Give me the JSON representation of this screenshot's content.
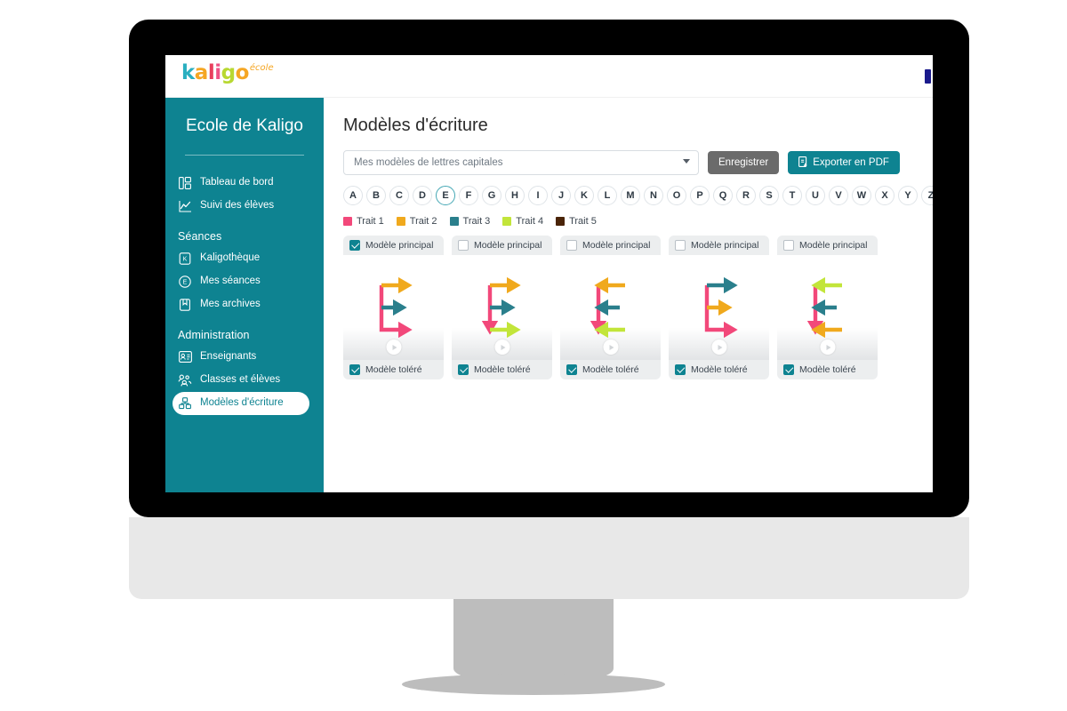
{
  "brand": {
    "logo_text": "kaligo",
    "logo_sup": "école",
    "logo_letter_colors": [
      "#2aafc0",
      "#f5a623",
      "#e8405e",
      "#ef5285",
      "#b8d832",
      "#f5a623"
    ],
    "accent": "#0e8391"
  },
  "topbar": {
    "badge_name": "user-badge"
  },
  "sidebar": {
    "school_name": "Ecole de Kaligo",
    "items": [
      {
        "label": "Tableau de bord",
        "icon": "dashboard-icon",
        "type": "link",
        "active": false
      },
      {
        "label": "Suivi des élèves",
        "icon": "chart-line-icon",
        "type": "link",
        "active": false
      },
      {
        "label": "Séances",
        "icon": "",
        "type": "section",
        "active": false
      },
      {
        "label": "Kaligothèque",
        "icon": "library-icon",
        "type": "link",
        "active": false
      },
      {
        "label": "Mes séances",
        "icon": "session-icon",
        "type": "link",
        "active": false
      },
      {
        "label": "Mes archives",
        "icon": "archive-icon",
        "type": "link",
        "active": false
      },
      {
        "label": "Administration",
        "icon": "",
        "type": "section",
        "active": false
      },
      {
        "label": "Enseignants",
        "icon": "teacher-card-icon",
        "type": "link",
        "active": false
      },
      {
        "label": "Classes et élèves",
        "icon": "students-icon",
        "type": "link",
        "active": false
      },
      {
        "label": "Modèles d'écriture",
        "icon": "writing-models-icon",
        "type": "link",
        "active": true
      }
    ]
  },
  "main": {
    "page_title": "Modèles d'écriture",
    "template_select": {
      "value": "Mes modèles de lettres capitales",
      "placeholder": "Mes modèles de lettres capitales"
    },
    "save_label": "Enregistrer",
    "export_label": "Exporter en PDF",
    "alphabet": [
      "A",
      "B",
      "C",
      "D",
      "E",
      "F",
      "G",
      "H",
      "I",
      "J",
      "K",
      "L",
      "M",
      "N",
      "O",
      "P",
      "Q",
      "R",
      "S",
      "T",
      "U",
      "V",
      "W",
      "X",
      "Y",
      "Z"
    ],
    "selected_letter": "E",
    "legend": [
      {
        "label": "Trait 1",
        "color": "#f2487a"
      },
      {
        "label": "Trait 2",
        "color": "#f0a91d"
      },
      {
        "label": "Trait 3",
        "color": "#2a7f8c"
      },
      {
        "label": "Trait 4",
        "color": "#c2e53a"
      },
      {
        "label": "Trait 5",
        "color": "#4a2408"
      }
    ],
    "card_labels": {
      "principal": "Modèle principal",
      "tolere": "Modèle toléré",
      "play": "play-icon"
    },
    "cards": [
      {
        "letter": "E",
        "principal_checked": true,
        "tolere_checked": true,
        "strokes": [
          {
            "trait": 1,
            "color": "#f2487a",
            "path": "vertical-down-then-bottom-right",
            "direction": "down-right"
          },
          {
            "trait": 2,
            "color": "#f0a91d",
            "path": "top-horizontal",
            "direction": "right"
          },
          {
            "trait": 3,
            "color": "#2a7f8c",
            "path": "middle-horizontal",
            "direction": "right"
          }
        ]
      },
      {
        "letter": "E",
        "principal_checked": false,
        "tolere_checked": true,
        "strokes": [
          {
            "trait": 1,
            "color": "#f2487a",
            "path": "vertical",
            "direction": "down"
          },
          {
            "trait": 2,
            "color": "#f0a91d",
            "path": "top-horizontal",
            "direction": "right"
          },
          {
            "trait": 3,
            "color": "#2a7f8c",
            "path": "middle-horizontal",
            "direction": "right"
          },
          {
            "trait": 4,
            "color": "#c2e53a",
            "path": "bottom-horizontal",
            "direction": "right"
          }
        ]
      },
      {
        "letter": "E",
        "principal_checked": false,
        "tolere_checked": true,
        "strokes": [
          {
            "trait": 1,
            "color": "#f2487a",
            "path": "vertical",
            "direction": "down"
          },
          {
            "trait": 2,
            "color": "#f0a91d",
            "path": "top-horizontal",
            "direction": "left"
          },
          {
            "trait": 3,
            "color": "#2a7f8c",
            "path": "middle-horizontal",
            "direction": "left"
          },
          {
            "trait": 4,
            "color": "#c2e53a",
            "path": "bottom-horizontal",
            "direction": "left"
          }
        ]
      },
      {
        "letter": "E",
        "principal_checked": false,
        "tolere_checked": true,
        "strokes": [
          {
            "trait": 1,
            "color": "#f2487a",
            "path": "vertical-down-then-bottom-right",
            "direction": "down-right"
          },
          {
            "trait": 2,
            "color": "#f0a91d",
            "path": "middle-horizontal",
            "direction": "right"
          },
          {
            "trait": 3,
            "color": "#2a7f8c",
            "path": "top-horizontal",
            "direction": "right"
          }
        ]
      },
      {
        "letter": "E",
        "principal_checked": false,
        "tolere_checked": true,
        "strokes": [
          {
            "trait": 1,
            "color": "#f2487a",
            "path": "vertical",
            "direction": "down"
          },
          {
            "trait": 2,
            "color": "#f0a91d",
            "path": "bottom-horizontal",
            "direction": "left"
          },
          {
            "trait": 3,
            "color": "#2a7f8c",
            "path": "middle-horizontal",
            "direction": "left"
          },
          {
            "trait": 4,
            "color": "#c2e53a",
            "path": "top-horizontal",
            "direction": "left"
          }
        ]
      }
    ]
  }
}
